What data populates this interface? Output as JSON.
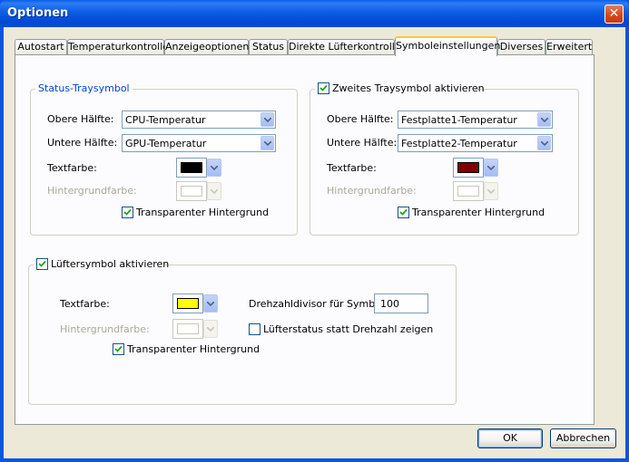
{
  "window": {
    "title": "Optionen",
    "close_glyph": "✕"
  },
  "tabs": [
    {
      "label": "Autostart"
    },
    {
      "label": "Temperaturkontrolle"
    },
    {
      "label": "Anzeigeoptionen"
    },
    {
      "label": "Status"
    },
    {
      "label": "Direkte Lüfterkontrolle"
    },
    {
      "label": "Symboleinstellungen",
      "active": true
    },
    {
      "label": "Diverses"
    },
    {
      "label": "Erweitert"
    }
  ],
  "status_tray": {
    "legend": "Status-Traysymbol",
    "upper_label": "Obere Hälfte:",
    "upper_value": "CPU-Temperatur",
    "lower_label": "Untere Hälfte:",
    "lower_value": "GPU-Temperatur",
    "text_color_label": "Textfarbe:",
    "text_color": "#000000",
    "bg_color_label": "Hintergrundfarbe:",
    "bg_color": "#ffffff",
    "transparent_label": "Transparenter Hintergrund",
    "transparent_checked": true
  },
  "second_tray": {
    "legend": "Zweites Traysymbol aktivieren",
    "enabled": true,
    "upper_label": "Obere Hälfte:",
    "upper_value": "Festplatte1-Temperatur",
    "lower_label": "Untere Hälfte:",
    "lower_value": "Festplatte2-Temperatur",
    "text_color_label": "Textfarbe:",
    "text_color": "#800000",
    "bg_color_label": "Hintergrundfarbe:",
    "bg_color": "#ffffff",
    "transparent_label": "Transparenter Hintergrund",
    "transparent_checked": true
  },
  "fan_symbol": {
    "legend": "Lüftersymbol aktivieren",
    "enabled": true,
    "text_color_label": "Textfarbe:",
    "text_color": "#ffff00",
    "bg_color_label": "Hintergrundfarbe:",
    "bg_color": "#ffffff",
    "transparent_label": "Transparenter Hintergrund",
    "transparent_checked": true,
    "divisor_label": "Drehzahldivisor für Symbol:",
    "divisor_value": "100",
    "fan_status_label": "Lüfterstatus statt Drehzahl zeigen",
    "fan_status_checked": false
  },
  "buttons": {
    "ok": "OK",
    "cancel": "Abbrechen"
  },
  "colors": {
    "accent": "#0046d5",
    "active_tab_highlight": "#ffc83c",
    "window_frame": "#0a56e0"
  }
}
